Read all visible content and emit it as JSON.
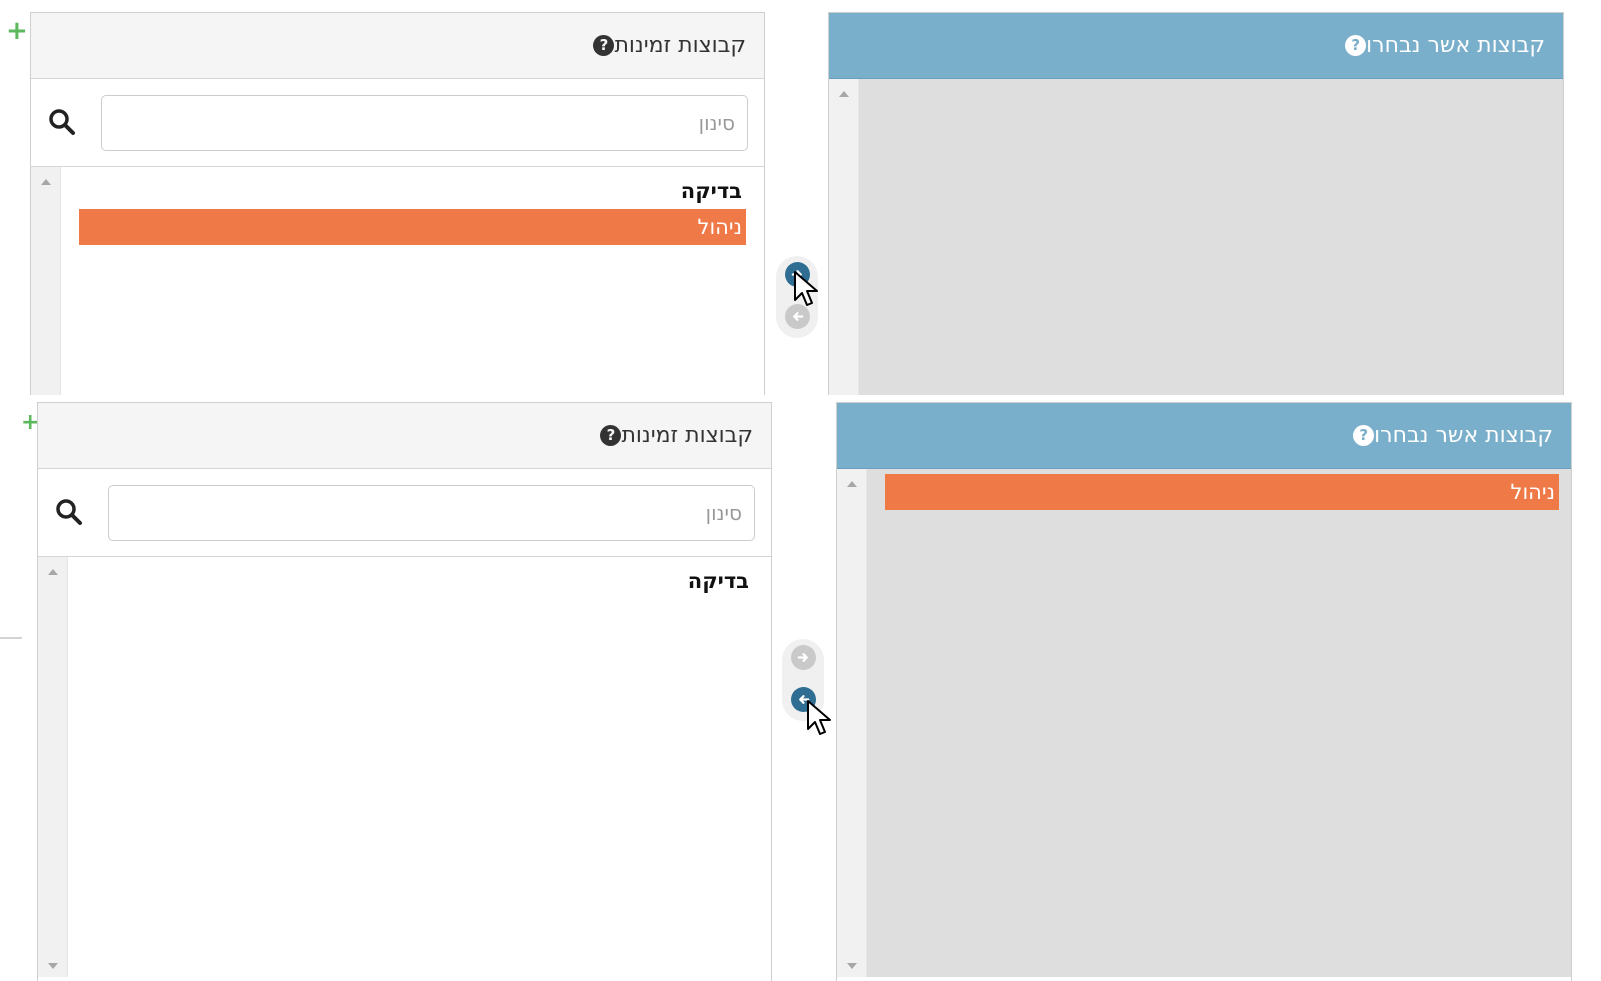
{
  "colors": {
    "selected_header_bg": "#7aafcc",
    "selected_item_bg": "#ef7a47",
    "active_button": "#2f6d93",
    "add_icon": "#5cb85c"
  },
  "icons": {
    "add": "plus-icon",
    "help": "question-circle-icon",
    "search": "magnifier-icon",
    "move_right": "arrow-circle-right-icon",
    "move_left": "arrow-circle-left-icon",
    "cursor": "mouse-pointer-icon"
  },
  "frames": [
    {
      "add_glyph": "+",
      "available": {
        "title": "קבוצות זמינות",
        "help_glyph": "?",
        "filter": {
          "placeholder": "סינון",
          "value": ""
        },
        "items": [
          {
            "label": "בדיקה",
            "selected": false
          },
          {
            "label": "ניהול",
            "selected": true
          }
        ]
      },
      "selected": {
        "title": "קבוצות אשר נבחרו",
        "help_glyph": "?",
        "items": []
      },
      "controls": {
        "move_right_enabled": true,
        "move_left_enabled": false
      }
    },
    {
      "add_glyph": "+",
      "available": {
        "title": "קבוצות זמינות",
        "help_glyph": "?",
        "filter": {
          "placeholder": "סינון",
          "value": ""
        },
        "items": [
          {
            "label": "בדיקה",
            "selected": false
          }
        ]
      },
      "selected": {
        "title": "קבוצות אשר נבחרו",
        "help_glyph": "?",
        "items": [
          {
            "label": "ניהול",
            "selected": true
          }
        ]
      },
      "controls": {
        "move_right_enabled": false,
        "move_left_enabled": true
      }
    }
  ]
}
